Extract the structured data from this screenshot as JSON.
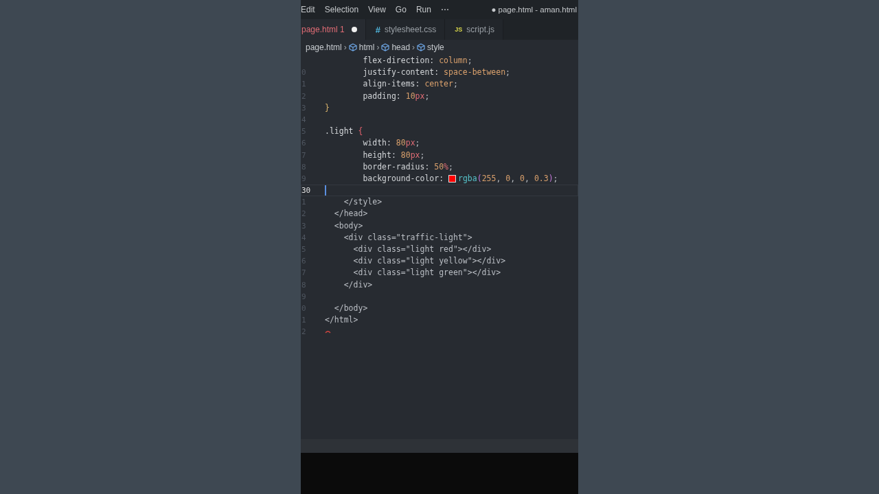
{
  "menu": [
    "Edit",
    "Selection",
    "View",
    "Go",
    "Run",
    "⋯"
  ],
  "window": {
    "title": "● page.html - aman.html"
  },
  "tabs": [
    {
      "label": "page.html",
      "kind": "html",
      "badge": "1",
      "modified": true,
      "selected": true
    },
    {
      "label": "stylesheet.css",
      "kind": "css",
      "icon": "#",
      "modified": false,
      "selected": false
    },
    {
      "label": "script.js",
      "kind": "js",
      "icon": "JS",
      "modified": false,
      "selected": false
    }
  ],
  "breadcrumb": [
    {
      "kind": "file",
      "label": "page.html"
    },
    {
      "kind": "sep",
      "label": "›"
    },
    {
      "kind": "symbol",
      "label": "html"
    },
    {
      "kind": "sep",
      "label": "›"
    },
    {
      "kind": "symbol",
      "label": "head"
    },
    {
      "kind": "sep",
      "label": "›"
    },
    {
      "kind": "symbol",
      "label": "style"
    }
  ],
  "lines": [
    {
      "active": false,
      "tokens": [
        {
          "kind": "prop",
          "text": "        flex-direction: "
        },
        {
          "kind": "value",
          "text": "column"
        },
        {
          "kind": "plain",
          "text": ";"
        }
      ]
    },
    {
      "number": "0",
      "active": false,
      "tokens": [
        {
          "kind": "prop",
          "text": "        justify-content: "
        },
        {
          "kind": "value",
          "text": "space-between"
        },
        {
          "kind": "plain",
          "text": ";"
        }
      ]
    },
    {
      "number": "1",
      "active": false,
      "tokens": [
        {
          "kind": "prop",
          "text": "        align-items: "
        },
        {
          "kind": "value",
          "text": "center"
        },
        {
          "kind": "plain",
          "text": ";"
        }
      ]
    },
    {
      "number": "2",
      "active": false,
      "tokens": [
        {
          "kind": "prop",
          "text": "        padding: "
        },
        {
          "kind": "value",
          "text": "10"
        },
        {
          "kind": "unit",
          "text": "px"
        },
        {
          "kind": "plain",
          "text": ";"
        }
      ]
    },
    {
      "number": "3",
      "active": false,
      "tokens": [
        {
          "kind": "closebrace",
          "text": "}"
        }
      ]
    },
    {
      "number": "4",
      "active": false
    },
    {
      "number": "5",
      "active": false,
      "tokens": [
        {
          "kind": "selector",
          "text": ".light "
        },
        {
          "kind": "brace",
          "text": "{"
        }
      ]
    },
    {
      "number": "6",
      "active": false,
      "tokens": [
        {
          "kind": "prop",
          "text": "        width: "
        },
        {
          "kind": "value",
          "text": "80"
        },
        {
          "kind": "unit",
          "text": "px"
        },
        {
          "kind": "plain",
          "text": ";"
        }
      ]
    },
    {
      "number": "7",
      "active": false,
      "tokens": [
        {
          "kind": "prop",
          "text": "        height: "
        },
        {
          "kind": "value",
          "text": "80"
        },
        {
          "kind": "unit",
          "text": "px"
        },
        {
          "kind": "plain",
          "text": ";"
        }
      ]
    },
    {
      "number": "8",
      "active": false,
      "tokens": [
        {
          "kind": "prop",
          "text": "        border-radius: "
        },
        {
          "kind": "value",
          "text": "50"
        },
        {
          "kind": "unit",
          "text": "%"
        },
        {
          "kind": "plain",
          "text": ";"
        }
      ]
    },
    {
      "number": "9",
      "active": false,
      "tokens": [
        {
          "kind": "prop",
          "text": "        background-color: "
        },
        {
          "kind": "swatch",
          "color": "#ff0000"
        },
        {
          "kind": "func",
          "text": "rgba"
        },
        {
          "kind": "paren",
          "text": "("
        },
        {
          "kind": "value",
          "text": "255"
        },
        {
          "kind": "plain",
          "text": ", "
        },
        {
          "kind": "value",
          "text": "0"
        },
        {
          "kind": "plain",
          "text": ", "
        },
        {
          "kind": "value",
          "text": "0"
        },
        {
          "kind": "plain",
          "text": ", "
        },
        {
          "kind": "value",
          "text": "0.3"
        },
        {
          "kind": "paren",
          "text": ")"
        },
        {
          "kind": "plain",
          "text": ";"
        }
      ]
    },
    {
      "number": "30",
      "active": true
    },
    {
      "number": "1",
      "active": false,
      "tokens": [
        {
          "kind": "plain",
          "text": "    </style>"
        }
      ]
    },
    {
      "number": "2",
      "active": false,
      "tokens": [
        {
          "kind": "plain",
          "text": "  </head>"
        }
      ]
    },
    {
      "number": "3",
      "active": false,
      "tokens": [
        {
          "kind": "plain",
          "text": "  <body>"
        }
      ]
    },
    {
      "number": "4",
      "active": false,
      "tokens": [
        {
          "kind": "plain",
          "text": "    <div class=\"traffic-light\">"
        }
      ]
    },
    {
      "number": "5",
      "active": false,
      "tokens": [
        {
          "kind": "plain",
          "text": "      <div class=\"light red\"></div>"
        }
      ]
    },
    {
      "number": "6",
      "active": false,
      "tokens": [
        {
          "kind": "plain",
          "text": "      <div class=\"light yellow\"></div>"
        }
      ]
    },
    {
      "number": "7",
      "active": false,
      "tokens": [
        {
          "kind": "plain",
          "text": "      <div class=\"light green\"></div>"
        }
      ]
    },
    {
      "number": "8",
      "active": false,
      "tokens": [
        {
          "kind": "plain",
          "text": "    </div>"
        }
      ]
    },
    {
      "number": "9",
      "active": false
    },
    {
      "number": "0",
      "active": false,
      "tokens": [
        {
          "kind": "plain",
          "text": "  </body>"
        }
      ]
    },
    {
      "number": "1",
      "active": false,
      "tokens": [
        {
          "kind": "plain",
          "text": "</html>"
        }
      ]
    },
    {
      "number": "2",
      "active": false,
      "error": true
    }
  ]
}
